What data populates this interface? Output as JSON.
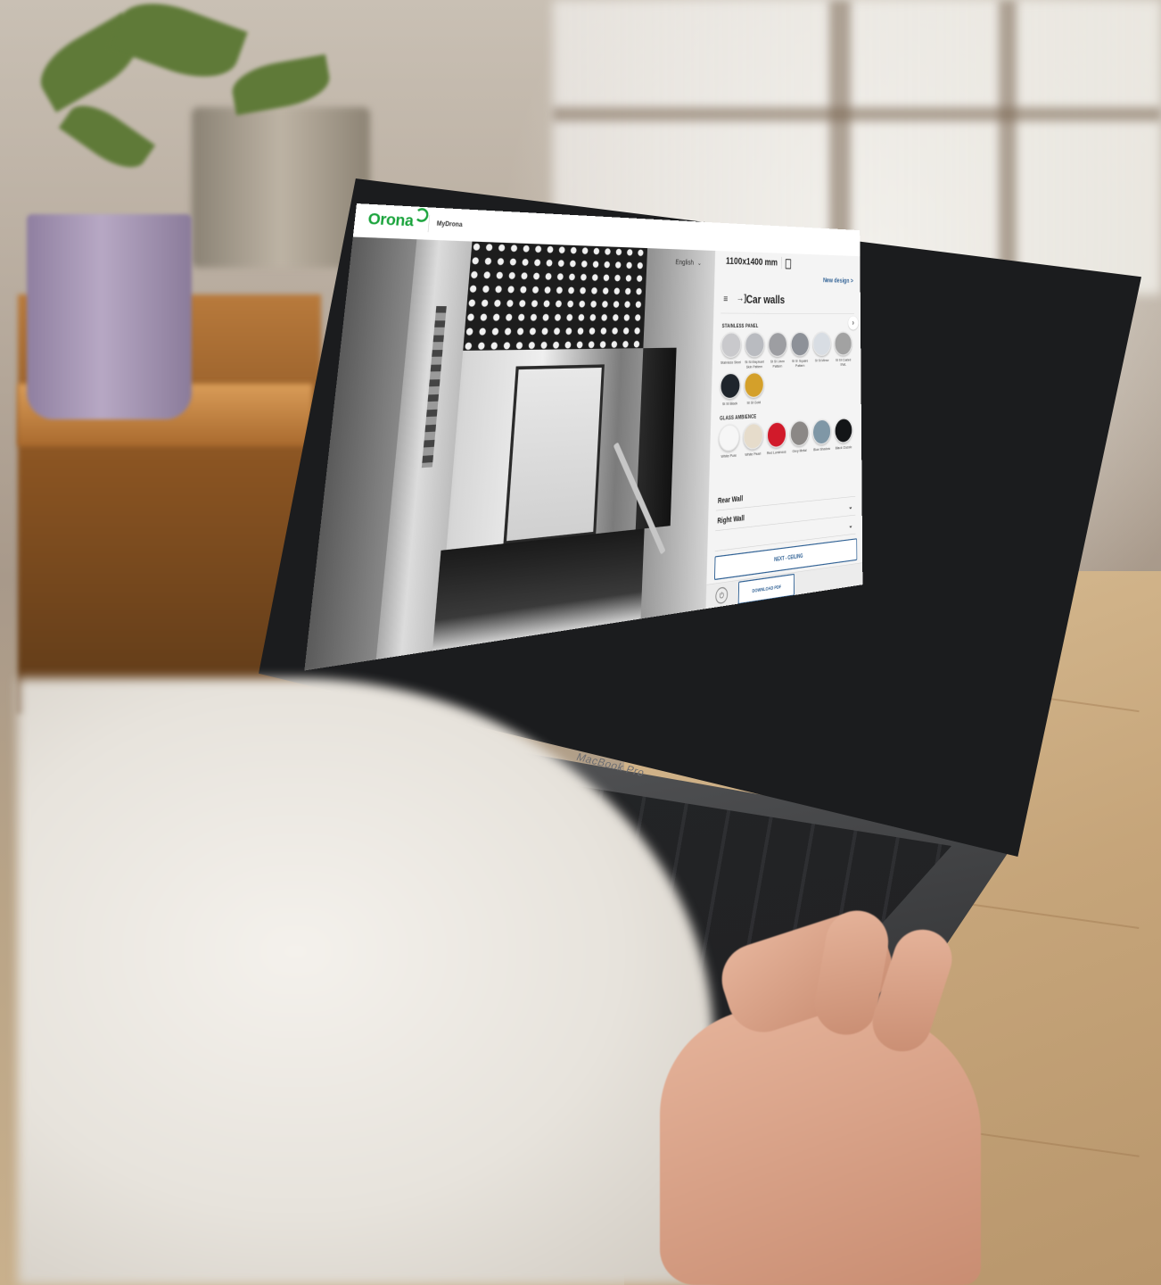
{
  "app": {
    "brand": "Orona",
    "section": "MyDrona",
    "language": "English",
    "cabin_size": "1100x1400 mm",
    "new_design": "New design >",
    "panel_title": "Car walls"
  },
  "laptop": {
    "model": "MacBook Pro"
  },
  "materials": [
    {
      "heading": "STAINLESS PANEL",
      "items": [
        {
          "label": "Stainless Steel",
          "color": "#c9c9cc"
        },
        {
          "label": "St St Elephant Skin Pattern",
          "color": "#b9bbc0"
        },
        {
          "label": "St St Linen Pattern",
          "color": "#9d9ea2"
        },
        {
          "label": "St St Square Pattern",
          "color": "#8d9198"
        },
        {
          "label": "St St Mirror",
          "color": "#d8dde3"
        },
        {
          "label": "St St Coated SWL",
          "color": "#a2a2a2"
        },
        {
          "label": "St St Black",
          "color": "#1f252c"
        },
        {
          "label": "St St Gold",
          "color": "#d4a02a"
        }
      ]
    },
    {
      "heading": "GLASS AMBIENCE",
      "items": [
        {
          "label": "White Pure",
          "color": "#f6f6f6"
        },
        {
          "label": "White Pearl",
          "color": "#e6dccb"
        },
        {
          "label": "Red Luminous",
          "color": "#d11a2a"
        },
        {
          "label": "Grey Metal",
          "color": "#8b8886"
        },
        {
          "label": "Blue Shadow",
          "color": "#7f97a6"
        },
        {
          "label": "Black Classic",
          "color": "#131517"
        }
      ]
    }
  ],
  "walls": [
    {
      "label": "Rear Wall"
    },
    {
      "label": "Right Wall"
    }
  ],
  "actions": {
    "next": "NEXT - CEILING",
    "download": "DOWNLOAD PDF"
  }
}
